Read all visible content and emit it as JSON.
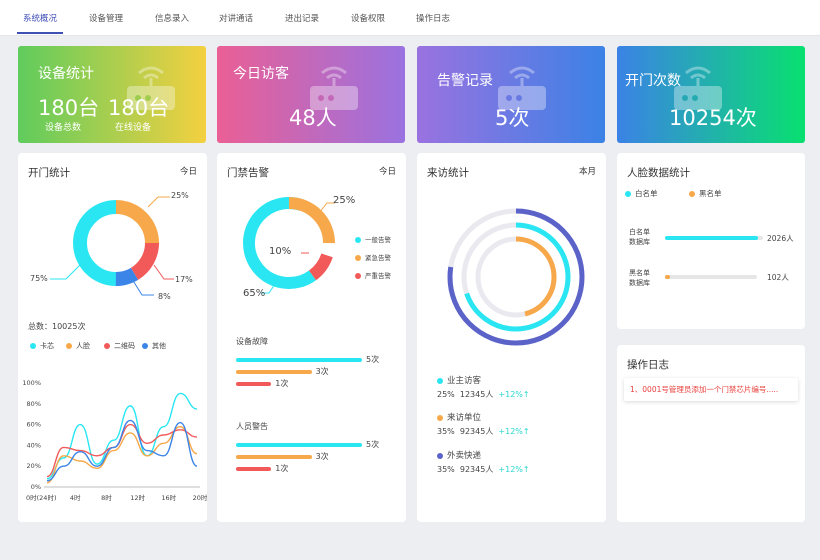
{
  "nav": {
    "tabs": [
      {
        "label": "系统概况"
      },
      {
        "label": "设备管理"
      },
      {
        "label": "信息录入"
      },
      {
        "label": "对讲通话"
      },
      {
        "label": "进出记录"
      },
      {
        "label": "设备权限"
      },
      {
        "label": "操作日志"
      }
    ]
  },
  "stats": {
    "devices": {
      "title": "设备统计",
      "total_value": "180台",
      "total_label": "设备总数",
      "online_value": "180台",
      "online_label": "在线设备"
    },
    "visitors": {
      "title": "今日访客",
      "value": "48人"
    },
    "alarms": {
      "title": "告警记录",
      "value": "5次"
    },
    "door_opens": {
      "title": "开门次数",
      "value": "10254次"
    }
  },
  "door_stats": {
    "title": "开门统计",
    "range": "今日",
    "total": "总数：10025次",
    "legend": [
      {
        "name": "卡芯",
        "color": "#29e6f2"
      },
      {
        "name": "人脸",
        "color": "#f7a84a"
      },
      {
        "name": "二维码",
        "color": "#f25a5a"
      },
      {
        "name": "其他",
        "color": "#3b84e8"
      }
    ],
    "donut_labels": {
      "a": "25%",
      "b": "17%",
      "c": "8%",
      "d": "75%"
    }
  },
  "access_alarm": {
    "title": "门禁告警",
    "range": "今日",
    "legend": [
      {
        "name": "一般告警",
        "color": "#29e6f2"
      },
      {
        "name": "紧急告警",
        "color": "#f7a84a"
      },
      {
        "name": "严重告警",
        "color": "#f25a5a"
      }
    ],
    "donut_labels": {
      "a": "25%",
      "b": "10%",
      "c": "65%"
    },
    "fault": {
      "title": "设备故障",
      "bars": [
        {
          "value": "5次",
          "color": "#29e6f2",
          "level": 1.0
        },
        {
          "value": "3次",
          "color": "#f7a84a",
          "level": 0.6
        },
        {
          "value": "1次",
          "color": "#f25a5a",
          "level": 0.28
        }
      ]
    },
    "personnel": {
      "title": "人员警告",
      "bars": [
        {
          "value": "5次",
          "color": "#29e6f2",
          "level": 1.0
        },
        {
          "value": "3次",
          "color": "#f7a84a",
          "level": 0.6
        },
        {
          "value": "1次",
          "color": "#f25a5a",
          "level": 0.28
        }
      ]
    }
  },
  "visit_stats": {
    "title": "来访统计",
    "range": "本月",
    "items": [
      {
        "name": "业主访客",
        "pct": "25%",
        "count": "12345人",
        "change": "+12%",
        "color": "#29e6f2"
      },
      {
        "name": "来访单位",
        "pct": "35%",
        "count": "92345人",
        "change": "+12%",
        "color": "#f7a84a"
      },
      {
        "name": "外卖快递",
        "pct": "35%",
        "count": "92345人",
        "change": "+12%",
        "color": "#5b63c9"
      }
    ]
  },
  "face_stats": {
    "title": "人脸数据统计",
    "legend": [
      {
        "name": "白名单",
        "color": "#29e6f2"
      },
      {
        "name": "黑名单",
        "color": "#f7a84a"
      }
    ],
    "rows": [
      {
        "label1": "白名单",
        "label2": "数据库",
        "value": "2026人",
        "level": 0.95,
        "color": "#29e6f2"
      },
      {
        "label1": "黑名单",
        "label2": "数据库",
        "value": "102人",
        "level": 0.05,
        "color": "#f7a84a"
      }
    ]
  },
  "op_log": {
    "title": "操作日志",
    "entries": [
      "1、0001号管理员添加一个门禁芯片编号....."
    ]
  },
  "chart_data": {
    "type": "line",
    "x": [
      "0时(24时)",
      "4时",
      "8时",
      "12时",
      "16时",
      "20时"
    ],
    "y_ticks": [
      "100%",
      "80%",
      "60%",
      "40%",
      "20%",
      "0%"
    ],
    "ylim": [
      0,
      100
    ],
    "series": [
      {
        "name": "卡芯",
        "color": "#29e6f2",
        "values": [
          8,
          28,
          60,
          22,
          45,
          78,
          30,
          58,
          90,
          75
        ]
      },
      {
        "name": "人脸",
        "color": "#f7a84a",
        "values": [
          4,
          30,
          25,
          18,
          35,
          52,
          30,
          42,
          58,
          32
        ]
      },
      {
        "name": "二维码",
        "color": "#f25a5a",
        "values": [
          10,
          38,
          35,
          30,
          38,
          60,
          42,
          50,
          55,
          48
        ]
      },
      {
        "name": "其他",
        "color": "#3b84e8",
        "values": [
          6,
          20,
          34,
          20,
          38,
          64,
          35,
          30,
          62,
          20
        ]
      }
    ]
  }
}
